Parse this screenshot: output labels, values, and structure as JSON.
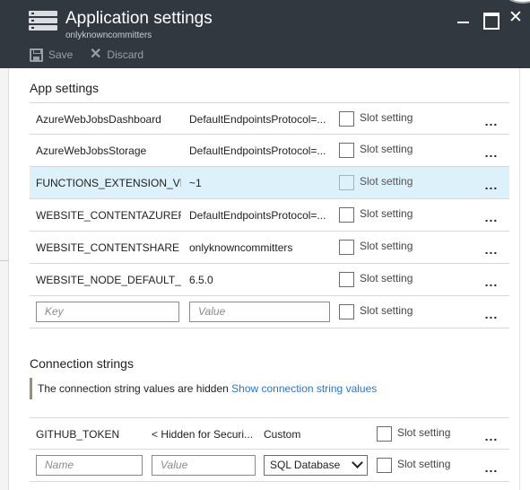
{
  "header": {
    "title": "Application settings",
    "subtitle": "onlyknowncommitters",
    "save_label": "Save",
    "discard_label": "Discard",
    "close_glyph": "✕"
  },
  "app_settings": {
    "title": "App settings",
    "slot_label": "Slot setting",
    "more_glyph": "...",
    "rows": [
      {
        "key": "AzureWebJobsDashboard",
        "value": "DefaultEndpointsProtocol=..."
      },
      {
        "key": "AzureWebJobsStorage",
        "value": "DefaultEndpointsProtocol=..."
      },
      {
        "key": "FUNCTIONS_EXTENSION_VE...",
        "value": "~1"
      },
      {
        "key": "WEBSITE_CONTENTAZUREFI...",
        "value": "DefaultEndpointsProtocol=..."
      },
      {
        "key": "WEBSITE_CONTENTSHARE",
        "value": "onlyknowncommitters"
      },
      {
        "key": "WEBSITE_NODE_DEFAULT_V...",
        "value": "6.5.0"
      }
    ],
    "new_row": {
      "key_placeholder": "Key",
      "value_placeholder": "Value"
    }
  },
  "connection_strings": {
    "title": "Connection strings",
    "notice_text": "The connection string values are hidden",
    "notice_link": "Show connection string values",
    "rows": [
      {
        "name": "GITHUB_TOKEN",
        "value": "< Hidden for Securi...",
        "type": "Custom"
      }
    ],
    "new_row": {
      "name_placeholder": "Name",
      "value_placeholder": "Value",
      "type_selected": "SQL Database"
    }
  },
  "colors": {
    "header_bg": "#32383f",
    "selected_row": "#dcf1fa",
    "link": "#2b78c5"
  },
  "icons": {
    "blade": "settings-blade-icon",
    "save": "save-icon",
    "discard": "discard-x-icon",
    "minimize": "minimize-icon",
    "maximize": "maximize-icon",
    "close": "close-icon"
  }
}
